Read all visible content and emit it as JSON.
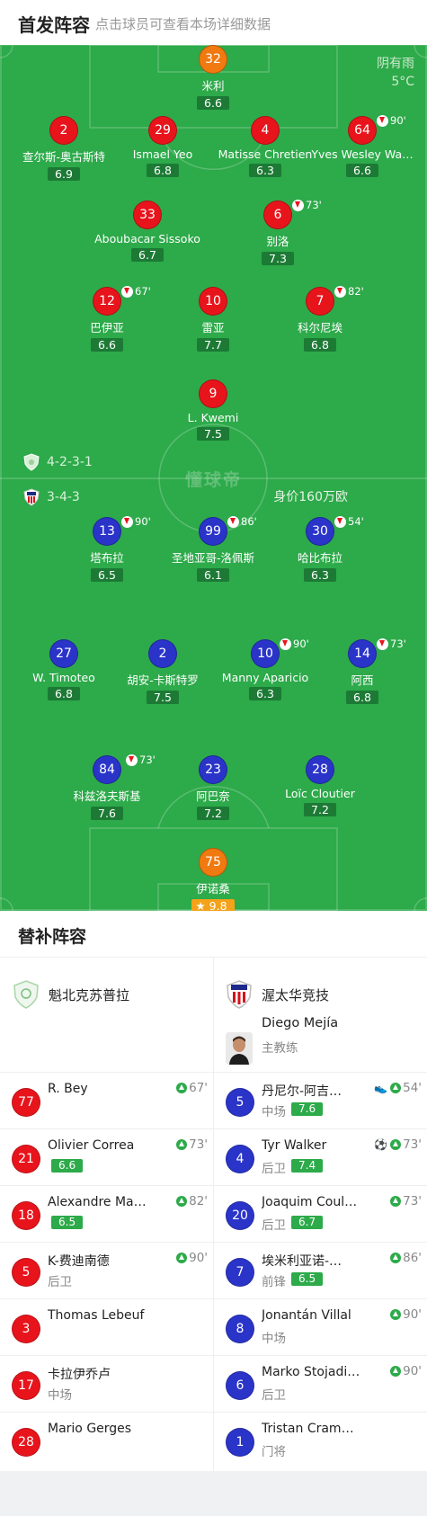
{
  "header": {
    "title": "首发阵容",
    "hint": "点击球员可查看本场详细数据"
  },
  "weather": {
    "condition": "阴有雨",
    "temp": "5°C"
  },
  "watermark": "懂球帝",
  "home_team": {
    "formation": "4-2-3-1"
  },
  "away_team": {
    "formation": "3-4-3",
    "value": "身价160万欧"
  },
  "home_players": [
    {
      "number": "32",
      "name": "米利",
      "rating": "6.6",
      "color": "#f07a10"
    },
    {
      "number": "2",
      "name": "查尔斯-奥古斯特",
      "rating": "6.9",
      "color": "#e8141c"
    },
    {
      "number": "29",
      "name": "Ismael Yeo",
      "rating": "6.8",
      "color": "#e8141c"
    },
    {
      "number": "4",
      "name": "Matisse Chretien",
      "rating": "6.3",
      "color": "#e8141c",
      "yellow": true
    },
    {
      "number": "64",
      "name": "Yves Wesley Wa…",
      "rating": "6.6",
      "color": "#e8141c",
      "sub": "90'"
    },
    {
      "number": "33",
      "name": "Aboubacar Sissoko",
      "rating": "6.7",
      "color": "#e8141c",
      "yellow": true
    },
    {
      "number": "6",
      "name": "别洛",
      "rating": "7.3",
      "color": "#e8141c",
      "sub": "73'"
    },
    {
      "number": "12",
      "name": "巴伊亚",
      "rating": "6.6",
      "color": "#e8141c",
      "sub": "67'"
    },
    {
      "number": "10",
      "name": "雷亚",
      "rating": "7.7",
      "color": "#e8141c"
    },
    {
      "number": "7",
      "name": "科尔尼埃",
      "rating": "6.8",
      "color": "#e8141c",
      "sub": "82'",
      "captain": "C"
    },
    {
      "number": "9",
      "name": "L. Kwemi",
      "rating": "7.5",
      "color": "#e8141c"
    }
  ],
  "away_players": [
    {
      "number": "13",
      "name": "塔布拉",
      "rating": "6.5",
      "color": "#2a34c9",
      "sub": "90'"
    },
    {
      "number": "99",
      "name": "圣地亚哥-洛佩斯",
      "rating": "6.1",
      "color": "#2a34c9",
      "sub": "86'"
    },
    {
      "number": "30",
      "name": "哈比布拉",
      "rating": "6.3",
      "color": "#2a34c9",
      "sub": "54'"
    },
    {
      "number": "27",
      "name": "W. Timoteo",
      "rating": "6.8",
      "color": "#2a34c9"
    },
    {
      "number": "2",
      "name": "胡安-卡斯特罗",
      "rating": "7.5",
      "color": "#2a34c9"
    },
    {
      "number": "10",
      "name": "Manny Aparicio",
      "rating": "6.3",
      "color": "#2a34c9",
      "sub": "90'",
      "captain": "C"
    },
    {
      "number": "14",
      "name": "阿西",
      "rating": "6.8",
      "color": "#2a34c9",
      "sub": "73'"
    },
    {
      "number": "84",
      "name": "科兹洛夫斯基",
      "rating": "7.6",
      "color": "#2a34c9",
      "sub": "73'",
      "yellow": true
    },
    {
      "number": "23",
      "name": "阿巴奈",
      "rating": "7.2",
      "color": "#2a34c9"
    },
    {
      "number": "28",
      "name": "Loïc Cloutier",
      "rating": "7.2",
      "color": "#2a34c9"
    },
    {
      "number": "75",
      "name": "伊诺桑",
      "rating": "9.8",
      "color": "#f07a10",
      "gold": true
    }
  ],
  "subs": {
    "title": "替补阵容",
    "home_name": "魁北克苏普拉",
    "away_name": "渥太华竞技",
    "coach": {
      "name": "Diego Mejía",
      "role": "主教练"
    },
    "home": [
      {
        "number": "77",
        "name": "R. Bey",
        "event": "67'",
        "color": "#e8141c"
      },
      {
        "number": "21",
        "name": "Olivier Correa",
        "rating": "6.6",
        "event": "73'",
        "color": "#e8141c"
      },
      {
        "number": "18",
        "name": "Alexandre Ma…",
        "rating": "6.5",
        "event": "82'",
        "color": "#e8141c"
      },
      {
        "number": "5",
        "name": "K-费迪南德",
        "position": "后卫",
        "event": "90'",
        "color": "#e8141c"
      },
      {
        "number": "3",
        "name": "Thomas Lebeuf",
        "color": "#e8141c"
      },
      {
        "number": "17",
        "name": "卡拉伊乔卢",
        "position": "中场",
        "color": "#e8141c"
      },
      {
        "number": "28",
        "name": "Mario Gerges",
        "color": "#e8141c"
      }
    ],
    "away": [
      {
        "number": "5",
        "name": "丹尼尔-阿吉…",
        "position": "中场",
        "rating": "7.6",
        "event": "54'",
        "extra": "assist",
        "color": "#2a34c9"
      },
      {
        "number": "4",
        "name": "Tyr Walker",
        "position": "后卫",
        "rating": "7.4",
        "event": "73'",
        "extra": "goal",
        "color": "#2a34c9"
      },
      {
        "number": "20",
        "name": "Joaquim Coul…",
        "position": "后卫",
        "rating": "6.7",
        "event": "73'",
        "color": "#2a34c9"
      },
      {
        "number": "7",
        "name": "埃米利亚诺-…",
        "position": "前锋",
        "rating": "6.5",
        "event": "86'",
        "color": "#2a34c9"
      },
      {
        "number": "8",
        "name": "Jonantán Villal",
        "position": "中场",
        "event": "90'",
        "color": "#2a34c9"
      },
      {
        "number": "6",
        "name": "Marko Stojadi…",
        "position": "后卫",
        "event": "90'",
        "color": "#2a34c9"
      },
      {
        "number": "1",
        "name": "Tristan Cram…",
        "position": "门将",
        "color": "#2a34c9"
      }
    ]
  }
}
